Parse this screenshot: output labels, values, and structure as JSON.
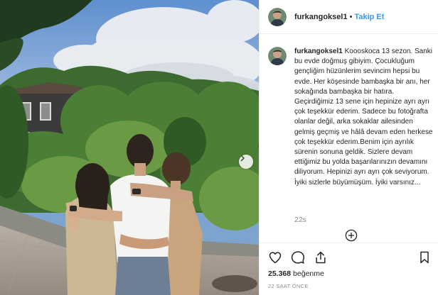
{
  "post": {
    "username": "furkangoksel1",
    "separator": "•",
    "follow_label": "Takip Et",
    "caption": "Koooskoca 13 sezon. Sanki bu evde doğmuş gibiyim. Çocukluğum gençliğim hüzünlerim sevincim hepsi bu evde. Her köşesinde bambaşka bir anı, her sokağında bambaşka bir hatıra. Geçirdiğimiz 13 sene için hepinize ayrı ayrı çok teşekkür ederim. Sadece bu fotoğrafta olanlar değil, arka sokaklar ailesinden gelmiş geçmiş ve hâlâ devam eden herkese çok teşekkür ederim.Benim için ayrılık sürenin sonuna geldik. Sizlere devam ettiğimiz bu yolda başarılarınızın devamını diliyorum. Hepinizi ayrı ayrı çok seviyorum. İyiki sizlerle büyümüşüm. İyiki varsınız...",
    "comment_age": "22s",
    "likes_count": "25.368",
    "likes_label": "beğenme",
    "posted_ago": "22 SAAT ÖNCE"
  },
  "icons": {
    "like": "heart-icon",
    "comment": "comment-icon",
    "share": "share-icon",
    "save": "bookmark-icon",
    "next": "chevron-right-icon",
    "more": "plus-circle-icon"
  },
  "colors": {
    "follow": "#3897f0",
    "muted": "#8e8e8e",
    "text": "#262626",
    "border": "#efefef"
  }
}
